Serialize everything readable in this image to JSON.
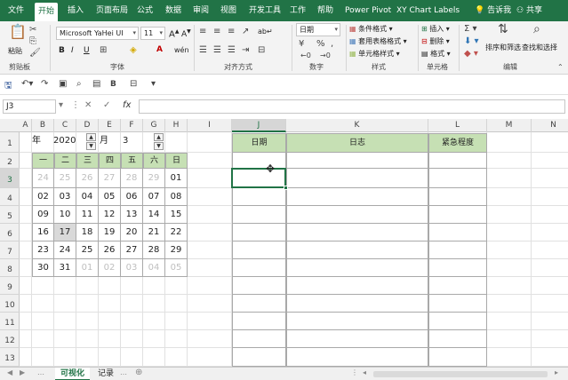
{
  "ribbon_tabs": [
    "文件",
    "开始",
    "插入",
    "页面布局",
    "公式",
    "数据",
    "审阅",
    "视图",
    "开发工具",
    "工作",
    "帮助",
    "Power Pivot",
    "XY Chart Labels",
    "告诉我"
  ],
  "active_tab": "开始",
  "share_label": "共享",
  "ribbon": {
    "paste_label": "粘贴",
    "clipboard_group": "剪贴板",
    "font_name": "Microsoft YaHei UI",
    "font_size": "11",
    "font_group": "字体",
    "align_group": "对齐方式",
    "number_format": "日期",
    "number_group": "数字",
    "style_items": [
      "条件格式",
      "套用表格格式",
      "单元格样式"
    ],
    "style_group": "样式",
    "cell_items": [
      "插入",
      "删除",
      "格式"
    ],
    "cell_group": "单元格",
    "sort_label": "排序和筛选",
    "find_label": "查找和选择",
    "edit_group": "编辑",
    "bold": "B",
    "italic": "I",
    "underline": "U",
    "font_grow": "A",
    "font_color": "A",
    "wrap": "ab"
  },
  "qat": {
    "bold_glyph": "B"
  },
  "formula_bar": {
    "name_box": "J3",
    "fx": "fx",
    "value": ""
  },
  "columns": [
    "A",
    "B",
    "C",
    "D",
    "E",
    "F",
    "G",
    "H",
    "I",
    "J",
    "K",
    "L",
    "M",
    "N"
  ],
  "selected_column": "J",
  "rows": [
    "1",
    "2",
    "3",
    "4",
    "5",
    "6",
    "7",
    "8",
    "9",
    "10",
    "11",
    "12",
    "13"
  ],
  "selected_row": "3",
  "calendar": {
    "year_label": "年",
    "year": "2020",
    "month_label": "月",
    "month": "3",
    "weekdays": [
      "一",
      "二",
      "三",
      "四",
      "五",
      "六",
      "日"
    ],
    "weeks": [
      [
        {
          "d": "24",
          "dim": true
        },
        {
          "d": "25",
          "dim": true
        },
        {
          "d": "26",
          "dim": true
        },
        {
          "d": "27",
          "dim": true
        },
        {
          "d": "28",
          "dim": true
        },
        {
          "d": "29",
          "dim": true
        },
        {
          "d": "01",
          "dim": false
        }
      ],
      [
        {
          "d": "02",
          "dim": false
        },
        {
          "d": "03",
          "dim": false
        },
        {
          "d": "04",
          "dim": false
        },
        {
          "d": "05",
          "dim": false
        },
        {
          "d": "06",
          "dim": false
        },
        {
          "d": "07",
          "dim": false
        },
        {
          "d": "08",
          "dim": false
        }
      ],
      [
        {
          "d": "09",
          "dim": false
        },
        {
          "d": "10",
          "dim": false
        },
        {
          "d": "11",
          "dim": false
        },
        {
          "d": "12",
          "dim": false
        },
        {
          "d": "13",
          "dim": false
        },
        {
          "d": "14",
          "dim": false
        },
        {
          "d": "15",
          "dim": false
        }
      ],
      [
        {
          "d": "16",
          "dim": false
        },
        {
          "d": "17",
          "dim": false,
          "today": true
        },
        {
          "d": "18",
          "dim": false
        },
        {
          "d": "19",
          "dim": false
        },
        {
          "d": "20",
          "dim": false
        },
        {
          "d": "21",
          "dim": false
        },
        {
          "d": "22",
          "dim": false
        }
      ],
      [
        {
          "d": "23",
          "dim": false
        },
        {
          "d": "24",
          "dim": false
        },
        {
          "d": "25",
          "dim": false
        },
        {
          "d": "26",
          "dim": false
        },
        {
          "d": "27",
          "dim": false
        },
        {
          "d": "28",
          "dim": false
        },
        {
          "d": "29",
          "dim": false
        }
      ],
      [
        {
          "d": "30",
          "dim": false
        },
        {
          "d": "31",
          "dim": false
        },
        {
          "d": "01",
          "dim": true
        },
        {
          "d": "02",
          "dim": true
        },
        {
          "d": "03",
          "dim": true
        },
        {
          "d": "04",
          "dim": true
        },
        {
          "d": "05",
          "dim": true
        }
      ]
    ]
  },
  "log_table": {
    "headers": [
      "日期",
      "日志",
      "紧急程度"
    ]
  },
  "sheets": [
    "可视化",
    "记录"
  ],
  "active_sheet": "可视化",
  "colors": {
    "accent": "#217346",
    "header_fill": "#c6e0b4",
    "dim_text": "#bfbfbf",
    "today_fill": "#d9d9d9"
  }
}
